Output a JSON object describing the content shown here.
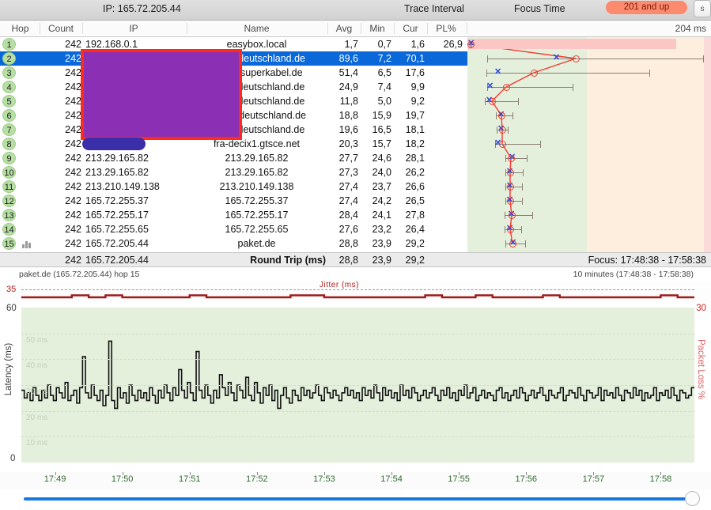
{
  "topbar": {
    "ip_label": "IP:  165.72.205.44",
    "trace_interval": "Trace Interval",
    "focus_time": "Focus Time",
    "badge": "201 and up",
    "corner_button": "s"
  },
  "columns": {
    "hop": "Hop",
    "count": "Count",
    "ip": "IP",
    "name": "Name",
    "avg": "Avg",
    "min": "Min",
    "cur": "Cur",
    "pl": "PL%",
    "scale_max": "204 ms"
  },
  "rows": [
    {
      "hop": "1",
      "count": "242",
      "ip": "192.168.0.1",
      "name": "easybox.local",
      "avg": "1,7",
      "min": "0,7",
      "cur": "1,6",
      "pl": "26,9",
      "selected": false,
      "redacted_ip": false,
      "redacted_name": false,
      "plot": {
        "center": 4,
        "lo": 3,
        "hi": 5,
        "x_center": 4,
        "x_pos": 4,
        "plbar": true,
        "plbar_width": 264
      }
    },
    {
      "hop": "2",
      "count": "242",
      "ip": "",
      "name": "na...el-deutschland.de",
      "avg": "89,6",
      "min": "7,2",
      "cur": "70,1",
      "pl": "",
      "selected": true,
      "redacted_ip": true,
      "redacted_name": true,
      "plot": {
        "center": 137,
        "lo": 25,
        "hi": 298,
        "x_pos": 112
      }
    },
    {
      "hop": "3",
      "count": "242",
      "ip": "",
      "name": "30-isp.superkabel.de",
      "avg": "51,4",
      "min": "6,5",
      "cur": "17,6",
      "pl": "",
      "selected": false,
      "redacted_ip": true,
      "redacted_name": false,
      "plot": {
        "center": 84,
        "lo": 24,
        "hi": 230,
        "x_pos": 38
      }
    },
    {
      "hop": "4",
      "count": "242",
      "ip": "",
      "name": "atic...l-deutschland.de",
      "avg": "24,9",
      "min": "7,4",
      "cur": "9,9",
      "pl": "",
      "selected": false,
      "redacted_ip": true,
      "redacted_name": false,
      "plot": {
        "center": 49,
        "lo": 25,
        "hi": 133,
        "x_pos": 28
      }
    },
    {
      "hop": "5",
      "count": "242",
      "ip": "",
      "name": "atic...l-deutschland.de",
      "avg": "11,8",
      "min": "5,0",
      "cur": "9,2",
      "pl": "",
      "selected": false,
      "redacted_ip": true,
      "redacted_name": false,
      "plot": {
        "center": 31,
        "lo": 22,
        "hi": 64,
        "x_pos": 27
      }
    },
    {
      "hop": "6",
      "count": "242",
      "ip": "",
      "name": "atic....l-deutschland.de",
      "avg": "18,8",
      "min": "15,9",
      "cur": "19,7",
      "pl": "",
      "selected": false,
      "redacted_ip": true,
      "redacted_name": false,
      "plot": {
        "center": 43,
        "lo": 36,
        "hi": 57,
        "x_pos": 42
      }
    },
    {
      "hop": "7",
      "count": "242",
      "ip": "",
      "name": "atic...l-deutschland.de",
      "avg": "19,6",
      "min": "16,5",
      "cur": "18,1",
      "pl": "",
      "selected": false,
      "redacted_ip": true,
      "redacted_name": false,
      "plot": {
        "center": 44,
        "lo": 37,
        "hi": 51,
        "x_pos": 42
      }
    },
    {
      "hop": "8",
      "count": "242",
      "ip": "",
      "name": "fra-decix1.gtsce.net",
      "avg": "20,3",
      "min": "15,7",
      "cur": "18,2",
      "pl": "",
      "selected": false,
      "redacted_ip": true,
      "redacted_name": false,
      "plot": {
        "center": 44,
        "lo": 35,
        "hi": 92,
        "x_pos": 38
      }
    },
    {
      "hop": "9",
      "count": "242",
      "ip": "213.29.165.82",
      "name": "213.29.165.82",
      "avg": "27,7",
      "min": "24,6",
      "cur": "28,1",
      "pl": "",
      "selected": false,
      "redacted_ip": false,
      "redacted_name": false,
      "plot": {
        "center": 55,
        "lo": 48,
        "hi": 75,
        "x_pos": 56
      }
    },
    {
      "hop": "10",
      "count": "242",
      "ip": "213.29.165.82",
      "name": "213.29.165.82",
      "avg": "27,3",
      "min": "24,0",
      "cur": "26,2",
      "pl": "",
      "selected": false,
      "redacted_ip": false,
      "redacted_name": false,
      "plot": {
        "center": 54,
        "lo": 48,
        "hi": 70,
        "x_pos": 53
      }
    },
    {
      "hop": "11",
      "count": "242",
      "ip": "213.210.149.138",
      "name": "213.210.149.138",
      "avg": "27,4",
      "min": "23,7",
      "cur": "26,6",
      "pl": "",
      "selected": false,
      "redacted_ip": false,
      "redacted_name": false,
      "plot": {
        "center": 54,
        "lo": 48,
        "hi": 69,
        "x_pos": 53
      }
    },
    {
      "hop": "12",
      "count": "242",
      "ip": "165.72.255.37",
      "name": "165.72.255.37",
      "avg": "27,4",
      "min": "24,2",
      "cur": "26,5",
      "pl": "",
      "selected": false,
      "redacted_ip": false,
      "redacted_name": false,
      "plot": {
        "center": 54,
        "lo": 48,
        "hi": 69,
        "x_pos": 53
      }
    },
    {
      "hop": "13",
      "count": "242",
      "ip": "165.72.255.17",
      "name": "165.72.255.17",
      "avg": "28,4",
      "min": "24,1",
      "cur": "27,8",
      "pl": "",
      "selected": false,
      "redacted_ip": false,
      "redacted_name": false,
      "plot": {
        "center": 56,
        "lo": 47,
        "hi": 82,
        "x_pos": 55
      }
    },
    {
      "hop": "14",
      "count": "242",
      "ip": "165.72.255.65",
      "name": "165.72.255.65",
      "avg": "27,6",
      "min": "23,2",
      "cur": "26,4",
      "pl": "",
      "selected": false,
      "redacted_ip": false,
      "redacted_name": false,
      "plot": {
        "center": 54,
        "lo": 47,
        "hi": 68,
        "x_pos": 53
      }
    },
    {
      "hop": "15",
      "count": "242",
      "ip": "165.72.205.44",
      "name": "paket.de",
      "avg": "28,8",
      "min": "23,9",
      "cur": "29,2",
      "pl": "",
      "selected": false,
      "redacted_ip": false,
      "redacted_name": false,
      "has_chart_icon": true,
      "plot": {
        "center": 57,
        "lo": 48,
        "hi": 73,
        "x_pos": 57
      }
    }
  ],
  "summary": {
    "count": "242",
    "ip": "165.72.205.44",
    "round_trip_label": "Round Trip (ms)",
    "avg": "28,8",
    "min": "23,9",
    "cur": "29,2",
    "focus": "Focus: 17:48:38 - 17:58:38"
  },
  "jitter": {
    "left_label": "paket.de (165.72.205.44) hop 15",
    "right_label": "10 minutes (17:48:38 - 17:58:38)",
    "series_label": "Jitter (ms)",
    "ytick": "35"
  },
  "chart_data": {
    "type": "line",
    "title": "paket.de (165.72.205.44) hop 15",
    "xlabel": "",
    "ylabel": "Latency (ms)",
    "y2label": "Packet Loss %",
    "ylim": [
      0,
      60
    ],
    "y2lim": [
      0,
      30
    ],
    "ytick_top": "60",
    "ytick_bottom": "0",
    "y2tick_top": "30",
    "gridlabels": [
      "50 ms",
      "40 ms",
      "30 ms",
      "20 ms",
      "10 ms"
    ],
    "grid": true,
    "xticks": [
      "17:49",
      "17:50",
      "17:51",
      "17:52",
      "17:53",
      "17:54",
      "17:55",
      "17:56",
      "17:57",
      "17:58"
    ],
    "series": [
      {
        "name": "Latency (ms)",
        "color": "#111111",
        "values": [
          28,
          25,
          27,
          24,
          29,
          26,
          24,
          28,
          25,
          30,
          26,
          24,
          29,
          27,
          25,
          31,
          24,
          26,
          28,
          23,
          29,
          41,
          27,
          25,
          30,
          26,
          24,
          28,
          22,
          26,
          47,
          24,
          21,
          29,
          25,
          27,
          23,
          30,
          26,
          24,
          28,
          25,
          27,
          24,
          29,
          26,
          23,
          28,
          25,
          30,
          27,
          24,
          29,
          26,
          36,
          28,
          25,
          31,
          27,
          24,
          43,
          28,
          25,
          30,
          26,
          23,
          28,
          25,
          34,
          29,
          26,
          31,
          27,
          24,
          30,
          28,
          25,
          33,
          26,
          24,
          31,
          27,
          23,
          29,
          26,
          30,
          24,
          28,
          21,
          26,
          29,
          25,
          23,
          28,
          26,
          24,
          29,
          26,
          28,
          25,
          27,
          30,
          26,
          24,
          29,
          27,
          25,
          28,
          26,
          24,
          27,
          29,
          26,
          28,
          25,
          27,
          24,
          29,
          26,
          28,
          25,
          30,
          27,
          24,
          29,
          26,
          28,
          25,
          27,
          24,
          30,
          26,
          28,
          25,
          29,
          27,
          24,
          26,
          28,
          25,
          27,
          29,
          26,
          24,
          28,
          26,
          29,
          25,
          27,
          24,
          28,
          26,
          30,
          25,
          27,
          29,
          24,
          26,
          28,
          25,
          27,
          26,
          24,
          28,
          29,
          25,
          27,
          24,
          26,
          28,
          25,
          29,
          27,
          24,
          26,
          28,
          25,
          27,
          29,
          26,
          24,
          28,
          26,
          25,
          27,
          29,
          24,
          26,
          28,
          27,
          25,
          29,
          26,
          24,
          28,
          27,
          25,
          26,
          29,
          24,
          28,
          26,
          27,
          25,
          29,
          26,
          24,
          28,
          27,
          25,
          29,
          26,
          28,
          24,
          27,
          25,
          26,
          29,
          24,
          27,
          26,
          28,
          25,
          29,
          26,
          24,
          28,
          27,
          25,
          26,
          29
        ]
      },
      {
        "name": "Packet Loss %",
        "color": "#cc2222",
        "values": []
      }
    ]
  },
  "hop_graph": {
    "scale_max_label": "204 ms",
    "bands": {
      "green": "#e4efdc",
      "orange": "#fdeedd",
      "pink": "#fbdada"
    },
    "line_color": "#f23b30",
    "marker_color": "#2c48d8",
    "whisker_color": "#8a8075"
  },
  "slider": {
    "value": "100"
  }
}
